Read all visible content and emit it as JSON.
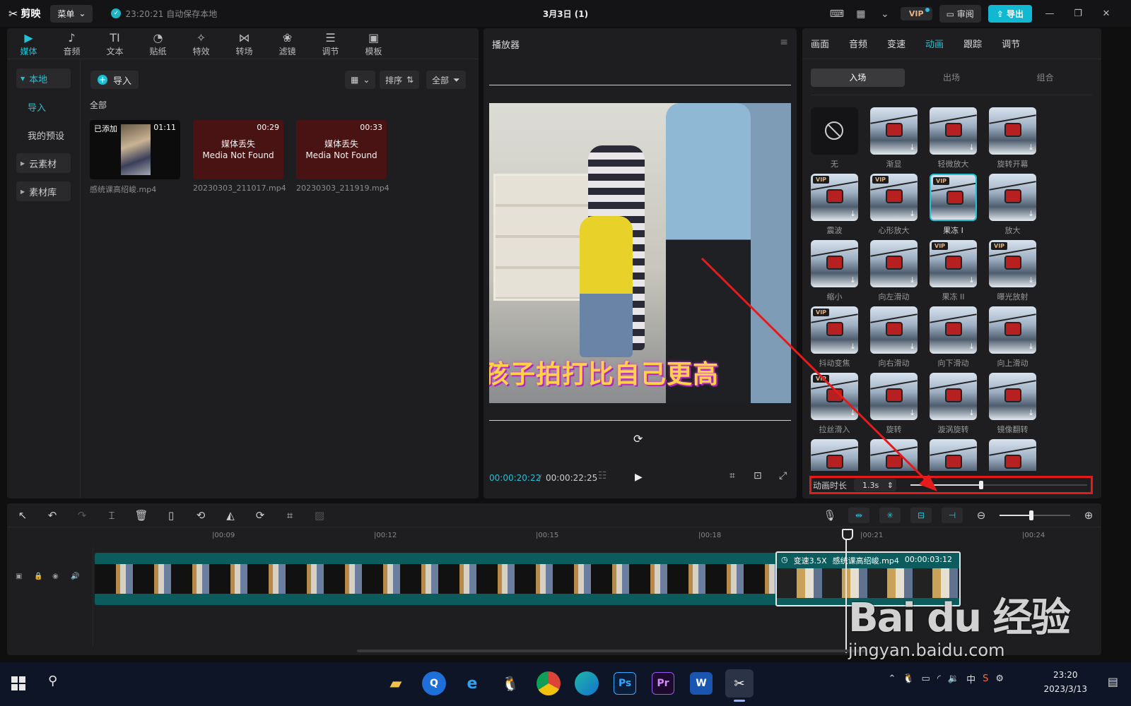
{
  "titlebar": {
    "logo": "剪映",
    "menu_label": "菜单",
    "save_status": "23:20:21 自动保存本地",
    "project_title": "3月3日 (1)",
    "vip_label": "VIP",
    "review_label": "审阅",
    "export_label": "导出"
  },
  "media_panel": {
    "tabs": [
      {
        "label": "媒体",
        "icon": "media-icon",
        "glyph": "▶"
      },
      {
        "label": "音频",
        "icon": "audio-icon",
        "glyph": "♪"
      },
      {
        "label": "文本",
        "icon": "text-icon",
        "glyph": "TI"
      },
      {
        "label": "贴纸",
        "icon": "sticker-icon",
        "glyph": "◔"
      },
      {
        "label": "特效",
        "icon": "effects-icon",
        "glyph": "✧"
      },
      {
        "label": "转场",
        "icon": "transition-icon",
        "glyph": "⋈"
      },
      {
        "label": "滤镜",
        "icon": "filter-icon",
        "glyph": "❀"
      },
      {
        "label": "调节",
        "icon": "adjust-icon",
        "glyph": "☰"
      },
      {
        "label": "模板",
        "icon": "template-icon",
        "glyph": "▣"
      }
    ],
    "sidebar": {
      "local": "本地",
      "import": "导入",
      "presets": "我的预设",
      "cloud": "云素材",
      "library": "素材库"
    },
    "import_button": "导入",
    "sort_label": "排序",
    "filter_label": "全部",
    "all_label": "全部",
    "items": [
      {
        "tag": "已添加",
        "duration": "01:11",
        "name": "感统课高绍峻.mp4"
      },
      {
        "duration": "00:29",
        "missing_cn": "媒体丢失",
        "missing_en": "Media Not Found",
        "name": "20230303_211017.mp4"
      },
      {
        "duration": "00:33",
        "missing_cn": "媒体丢失",
        "missing_en": "Media Not Found",
        "name": "20230303_211919.mp4"
      }
    ]
  },
  "player": {
    "title": "播放器",
    "caption": "孩子拍打比自己更高",
    "current_time": "00:00:20:22",
    "total_time": "00:00:22:25",
    "separator": "/"
  },
  "props_panel": {
    "tabs": [
      "画面",
      "音频",
      "变速",
      "动画",
      "跟踪",
      "调节"
    ],
    "active_tab": "动画",
    "segments": [
      "入场",
      "出场",
      "组合"
    ],
    "animations": [
      "无",
      "渐显",
      "轻微放大",
      "旋转开幕",
      "震波",
      "心形放大",
      "果冻 I",
      "放大",
      "缩小",
      "向左滑动",
      "果冻 II",
      "曝光放射",
      "抖动变焦",
      "向右滑动",
      "向下滑动",
      "向上滑动",
      "拉丝滑入",
      "旋转",
      "漩涡旋转",
      "镜像翻转",
      "",
      "",
      "",
      ""
    ],
    "duration_label": "动画时长",
    "duration_value": "1.3s",
    "duration_fraction": 0.4
  },
  "timeline": {
    "ticks": [
      "|00:09",
      "|00:12",
      "|00:15",
      "|00:18",
      "|00:21",
      "|00:24"
    ],
    "clip_speed": "变速3.5X",
    "clip_name": "感统课高绍峻.mp4",
    "clip_duration": "00:00:03:12",
    "zoom_fraction": 0.45
  },
  "watermark": {
    "brand": "Bai du 经验",
    "url": "jingyan.baidu.com"
  },
  "taskbar": {
    "clock_time": "23:20",
    "clock_date": "2023/3/13",
    "ime": "中"
  },
  "colors": {
    "accent": "#22c1d6",
    "export": "#11b8d1",
    "highlight_box": "#e51b1b",
    "missing_media": "#4a1313"
  }
}
